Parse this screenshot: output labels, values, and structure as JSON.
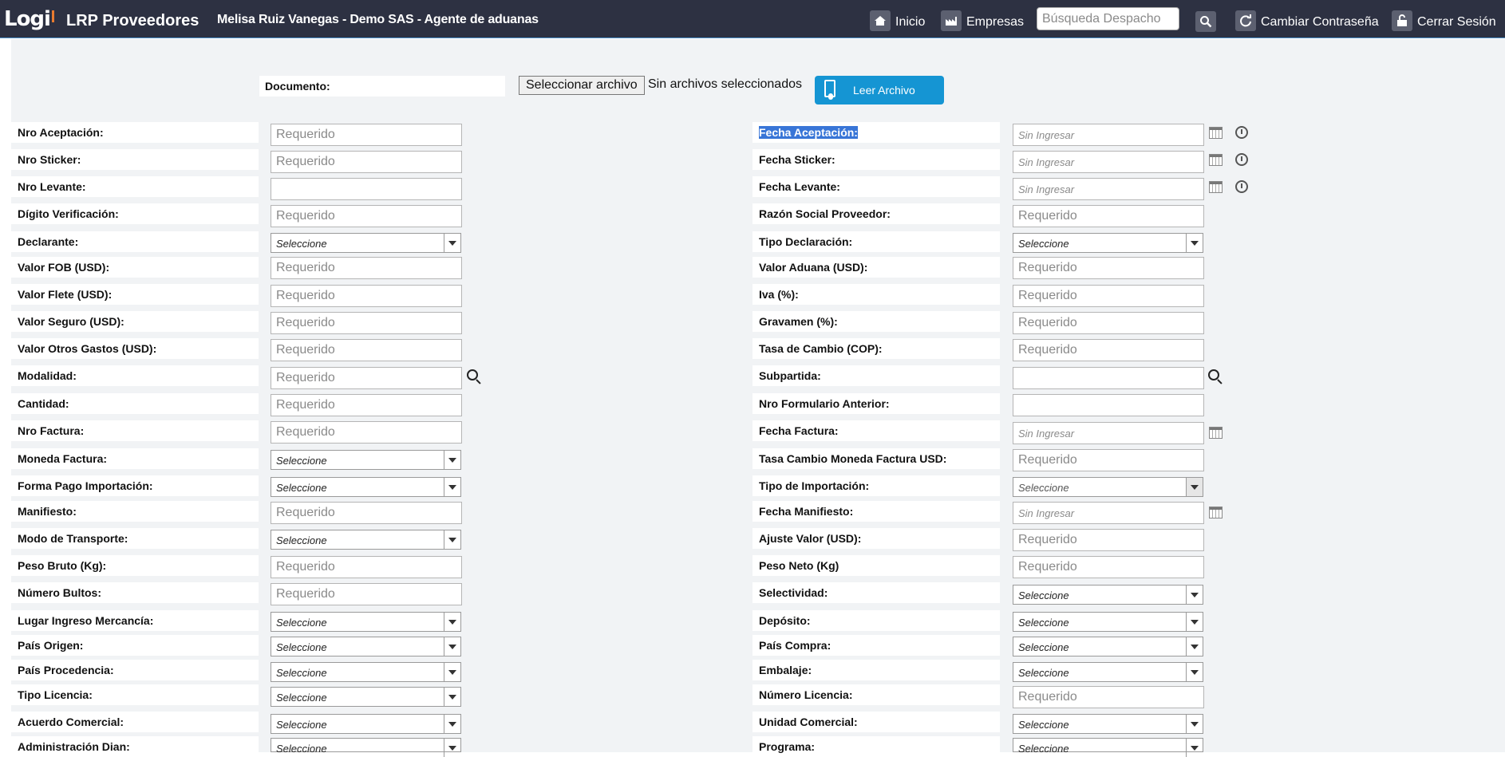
{
  "app": {
    "logo_text": "Logi",
    "title": "LRP Proveedores",
    "user_context": "Melisa Ruiz Vanegas - Demo SAS - Agente de aduanas"
  },
  "nav": {
    "home": "Inicio",
    "companies": "Empresas",
    "search_placeholder": "Búsqueda Despacho",
    "change_password": "Cambiar Contraseña",
    "logout": "Cerrar Sesión"
  },
  "document": {
    "label": "Documento:",
    "choose_file": "Seleccionar archivo",
    "no_file": "Sin archivos seleccionados",
    "read_button": "Leer Archivo"
  },
  "placeholders": {
    "required": "Requerido",
    "not_entered": "Sin Ingresar",
    "select": "Seleccione"
  },
  "left": {
    "nro_aceptacion": "Nro Aceptación:",
    "nro_sticker": "Nro Sticker:",
    "nro_levante": "Nro Levante:",
    "digito_verificacion": "Dígito Verificación:",
    "declarante": "Declarante:",
    "valor_fob": "Valor FOB (USD):",
    "valor_flete": "Valor Flete (USD):",
    "valor_seguro": "Valor Seguro (USD):",
    "valor_otros_gastos": "Valor Otros Gastos (USD):",
    "modalidad": "Modalidad:",
    "cantidad": "Cantidad:",
    "nro_factura": "Nro Factura:",
    "moneda_factura": "Moneda Factura:",
    "forma_pago": "Forma Pago Importación:",
    "manifiesto": "Manifiesto:",
    "modo_transporte": "Modo de Transporte:",
    "peso_bruto": "Peso Bruto (Kg):",
    "numero_bultos": "Número Bultos:",
    "lugar_ingreso": "Lugar Ingreso Mercancía:",
    "pais_origen": "País Origen:",
    "pais_procedencia": "País Procedencia:",
    "tipo_licencia": "Tipo Licencia:",
    "acuerdo_comercial": "Acuerdo Comercial:",
    "administracion_dian": "Administración Dian:"
  },
  "right": {
    "fecha_aceptacion": "Fecha Aceptación:",
    "fecha_sticker": "Fecha Sticker:",
    "fecha_levante": "Fecha Levante:",
    "razon_social": "Razón Social Proveedor:",
    "tipo_declaracion": "Tipo Declaración:",
    "valor_aduana": "Valor Aduana (USD):",
    "iva": "Iva (%):",
    "gravamen": "Gravamen (%):",
    "tasa_cambio": "Tasa de Cambio (COP):",
    "subpartida": "Subpartida:",
    "nro_formulario_anterior": "Nro Formulario Anterior:",
    "fecha_factura": "Fecha Factura:",
    "tasa_cambio_moneda": "Tasa Cambio Moneda Factura USD:",
    "tipo_importacion": "Tipo de Importación:",
    "fecha_manifiesto": "Fecha Manifiesto:",
    "ajuste_valor": "Ajuste Valor (USD):",
    "peso_neto": "Peso Neto (Kg)",
    "selectividad": "Selectividad:",
    "deposito": "Depósito:",
    "pais_compra": "País Compra:",
    "embalaje": "Embalaje:",
    "numero_licencia": "Número Licencia:",
    "unidad_comercial": "Unidad Comercial:",
    "programa": "Programa:"
  }
}
